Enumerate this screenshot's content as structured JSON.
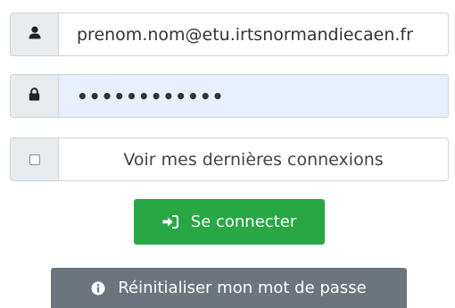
{
  "login_form": {
    "email": {
      "icon": "user-icon",
      "value": "prenom.nom@etu.irtsnormandiecaen.fr"
    },
    "password": {
      "icon": "lock-icon",
      "masked_value": "••••••••••••"
    },
    "show_last_logins": {
      "checked": false,
      "label": "Voir mes dernières connexions"
    },
    "submit_button": {
      "icon": "sign-in-icon",
      "label": "Se connecter",
      "color": "#28a745"
    },
    "reset_button": {
      "icon": "info-circle-icon",
      "label": "Réinitialiser mon mot de passe",
      "color": "#6c757d"
    }
  }
}
